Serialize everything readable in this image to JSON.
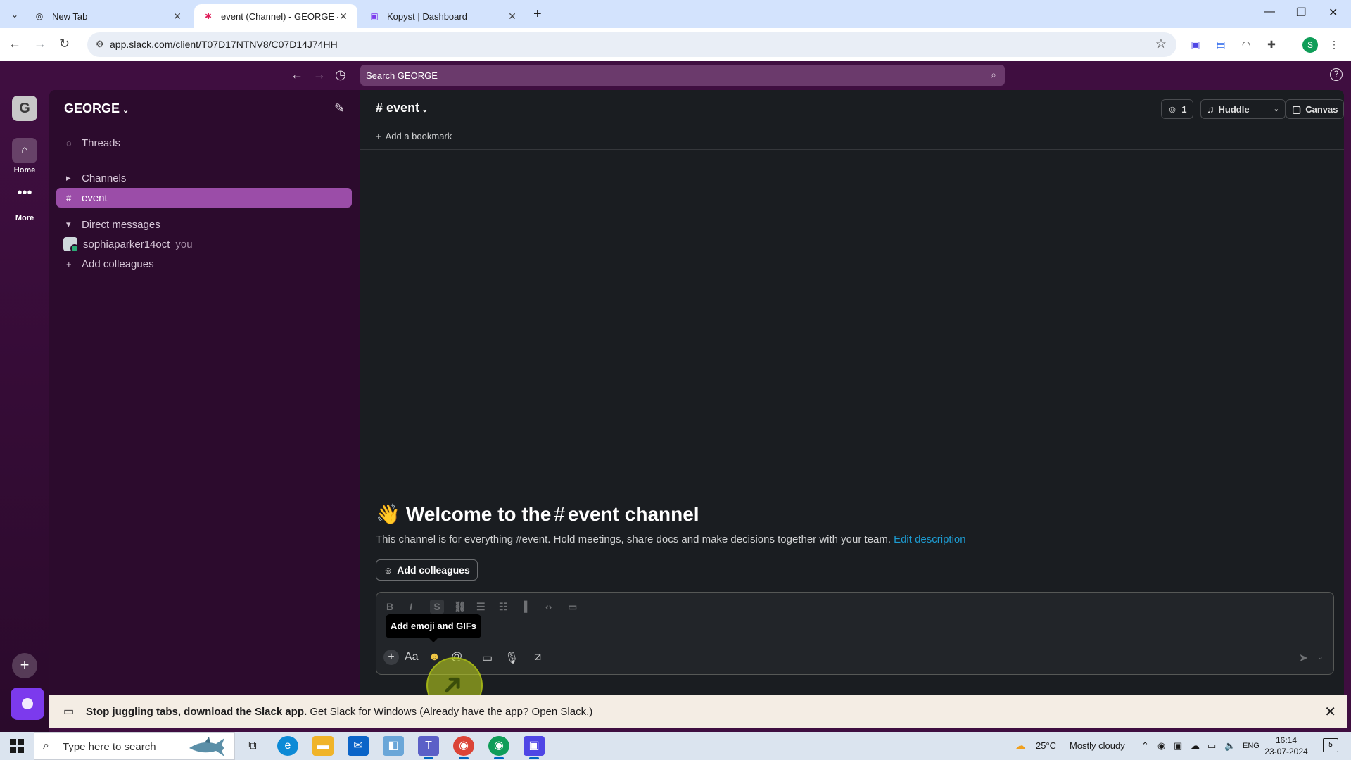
{
  "browser": {
    "tabs": [
      {
        "title": "New Tab",
        "icon": "chrome-icon"
      },
      {
        "title": "event (Channel) - GEORGE - Sla",
        "icon": "slack-icon"
      },
      {
        "title": "Kopyst | Dashboard",
        "icon": "kopyst-icon"
      }
    ],
    "url": "app.slack.com/client/T07D17NTNV8/C07D14J74HH",
    "profile_initial": "S"
  },
  "slack": {
    "search_placeholder": "Search GEORGE",
    "workspace_initial": "G",
    "workspace_name": "GEORGE",
    "rail": {
      "home_label": "Home",
      "more_label": "More"
    },
    "sidebar": {
      "threads": "Threads",
      "channels_header": "Channels",
      "channel": "event",
      "dm_header": "Direct messages",
      "dm_user": "sophiaparker14oct",
      "dm_you": "you",
      "add_colleagues": "Add colleagues"
    },
    "channel": {
      "name": "event",
      "add_bookmark": "Add a bookmark",
      "member_count": "1",
      "huddle": "Huddle",
      "canvas": "Canvas",
      "welcome_prefix": "Welcome to the",
      "welcome_hash": "#",
      "welcome_suffix": "event channel",
      "description": "This channel is for everything #event. Hold meetings, share docs and make decisions together with your team.",
      "edit_description": "Edit description",
      "add_colleagues_btn": "Add colleagues"
    },
    "composer": {
      "tooltip": "Add emoji and GIFs"
    },
    "banner": {
      "text": "Stop juggling tabs, download the Slack app.",
      "link1": "Get Slack for Windows",
      "middle": "(Already have the app?",
      "link2": "Open Slack",
      "end": ".)"
    }
  },
  "taskbar": {
    "search_placeholder": "Type here to search",
    "weather_temp": "25°C",
    "weather_desc": "Mostly cloudy",
    "lang": "ENG",
    "time": "16:14",
    "date": "23-07-2024",
    "notifications": "5"
  },
  "colors": {
    "slack_aubergine": "#3f0e40",
    "active_channel": "#9b4da8",
    "link_blue": "#1d9bd1",
    "main_bg": "#1a1d21"
  }
}
